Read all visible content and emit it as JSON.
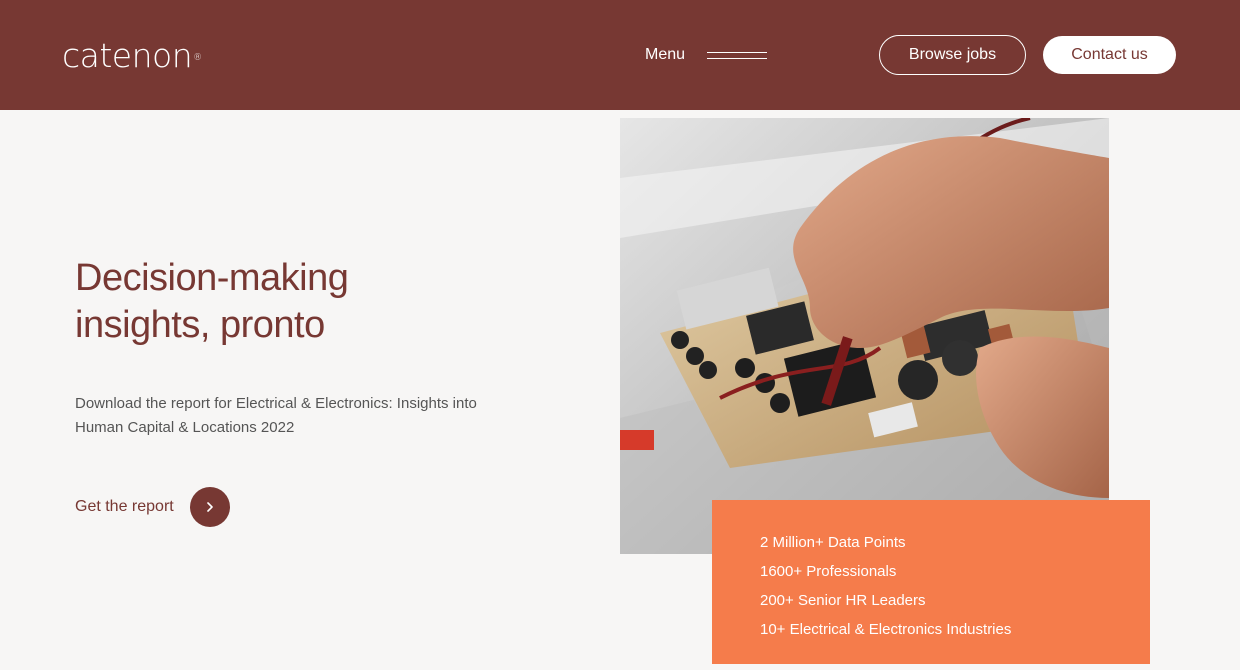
{
  "header": {
    "logo_text": "catenon",
    "logo_mark": "®",
    "menu_label": "Menu",
    "browse_jobs_label": "Browse jobs",
    "contact_label": "Contact us"
  },
  "hero": {
    "title_line1": "Decision-making",
    "title_line2": "insights, pronto",
    "description": "Download the report for Electrical & Electronics: Insights into Human Capital & Locations 2022",
    "cta_label": "Get the report"
  },
  "stats": [
    "2 Million+ Data Points",
    "1600+ Professionals",
    "200+ Senior HR Leaders",
    "10+ Electrical & Electronics Industries"
  ],
  "colors": {
    "brand": "#773833",
    "accent": "#f57c4b",
    "background": "#f7f6f5"
  },
  "icons": {
    "menu": "hamburger-icon",
    "cta": "chevron-right-icon"
  }
}
